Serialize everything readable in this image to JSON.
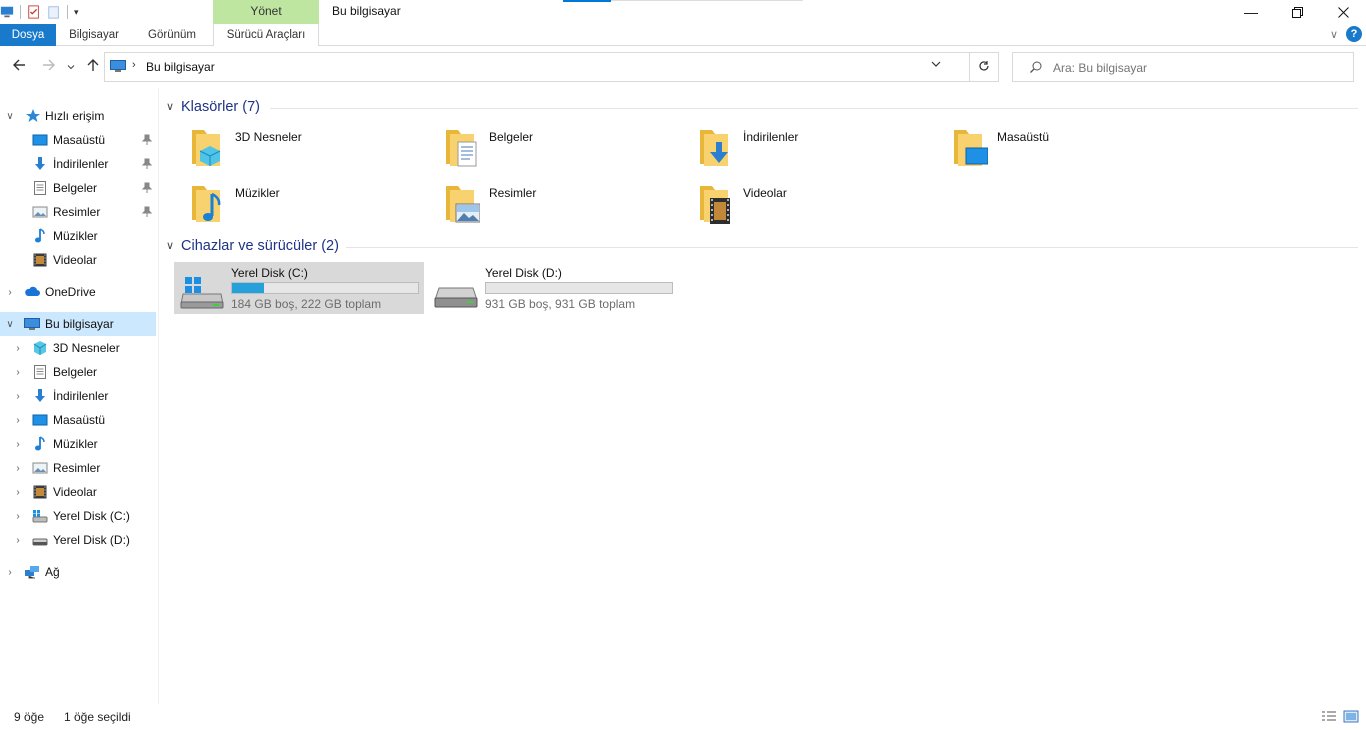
{
  "window": {
    "title": "Bu bilgisayar",
    "context_group_label": "Yönet"
  },
  "ribbon": {
    "tabs": [
      "Dosya",
      "Bilgisayar",
      "Görünüm",
      "Sürücü Araçları"
    ]
  },
  "navigation": {
    "back_icon": "arrow-left-icon",
    "forward_icon": "arrow-right-icon",
    "recent_icon": "chevron-down-icon",
    "up_icon": "arrow-up-icon"
  },
  "address": {
    "path": "Bu bilgisayar"
  },
  "search": {
    "placeholder": "Ara: Bu bilgisayar"
  },
  "sidebar": {
    "quick_access": "Hızlı erişim",
    "quick_items": [
      {
        "label": "Masaüstü",
        "icon": "desktop-icon",
        "pinned": true
      },
      {
        "label": "İndirilenler",
        "icon": "download-icon",
        "pinned": true
      },
      {
        "label": "Belgeler",
        "icon": "documents-icon",
        "pinned": true
      },
      {
        "label": "Resimler",
        "icon": "pictures-icon",
        "pinned": true
      },
      {
        "label": "Müzikler",
        "icon": "music-icon",
        "pinned": false
      },
      {
        "label": "Videolar",
        "icon": "videos-icon",
        "pinned": false
      }
    ],
    "onedrive": "OneDrive",
    "this_pc": "Bu bilgisayar",
    "pc_items": [
      {
        "label": "3D Nesneler",
        "icon": "3d-objects-icon"
      },
      {
        "label": "Belgeler",
        "icon": "documents-icon"
      },
      {
        "label": "İndirilenler",
        "icon": "download-icon"
      },
      {
        "label": "Masaüstü",
        "icon": "desktop-icon"
      },
      {
        "label": "Müzikler",
        "icon": "music-icon"
      },
      {
        "label": "Resimler",
        "icon": "pictures-icon"
      },
      {
        "label": "Videolar",
        "icon": "videos-icon"
      },
      {
        "label": "Yerel Disk (C:)",
        "icon": "system-drive-icon"
      },
      {
        "label": "Yerel Disk (D:)",
        "icon": "drive-icon"
      }
    ],
    "network": "Ağ"
  },
  "content": {
    "folders_title": "Klasörler (7)",
    "folders": [
      {
        "label": "3D Nesneler",
        "icon": "3d-objects-folder-icon"
      },
      {
        "label": "Belgeler",
        "icon": "documents-folder-icon"
      },
      {
        "label": "İndirilenler",
        "icon": "downloads-folder-icon"
      },
      {
        "label": "Masaüstü",
        "icon": "desktop-folder-icon"
      },
      {
        "label": "Müzikler",
        "icon": "music-folder-icon"
      },
      {
        "label": "Resimler",
        "icon": "pictures-folder-icon"
      },
      {
        "label": "Videolar",
        "icon": "videos-folder-icon"
      }
    ],
    "drives_title": "Cihazlar ve sürücüler (2)",
    "drives": [
      {
        "name": "Yerel Disk (C:)",
        "info": "184 GB boş, 222 GB toplam",
        "used_fraction": 0.171,
        "selected": true,
        "icon": "system-drive-icon"
      },
      {
        "name": "Yerel Disk (D:)",
        "info": "931 GB boş, 931 GB toplam",
        "used_fraction": 0.0,
        "selected": false,
        "icon": "drive-icon"
      }
    ]
  },
  "status": {
    "item_count": "9 öğe",
    "selection": "1 öğe seçildi"
  },
  "colors": {
    "accent": "#1979ca",
    "selection": "#cce8ff",
    "drive_bar": "#26a0da",
    "group_title": "#1e3287",
    "context_tab": "#bfe6a0"
  }
}
